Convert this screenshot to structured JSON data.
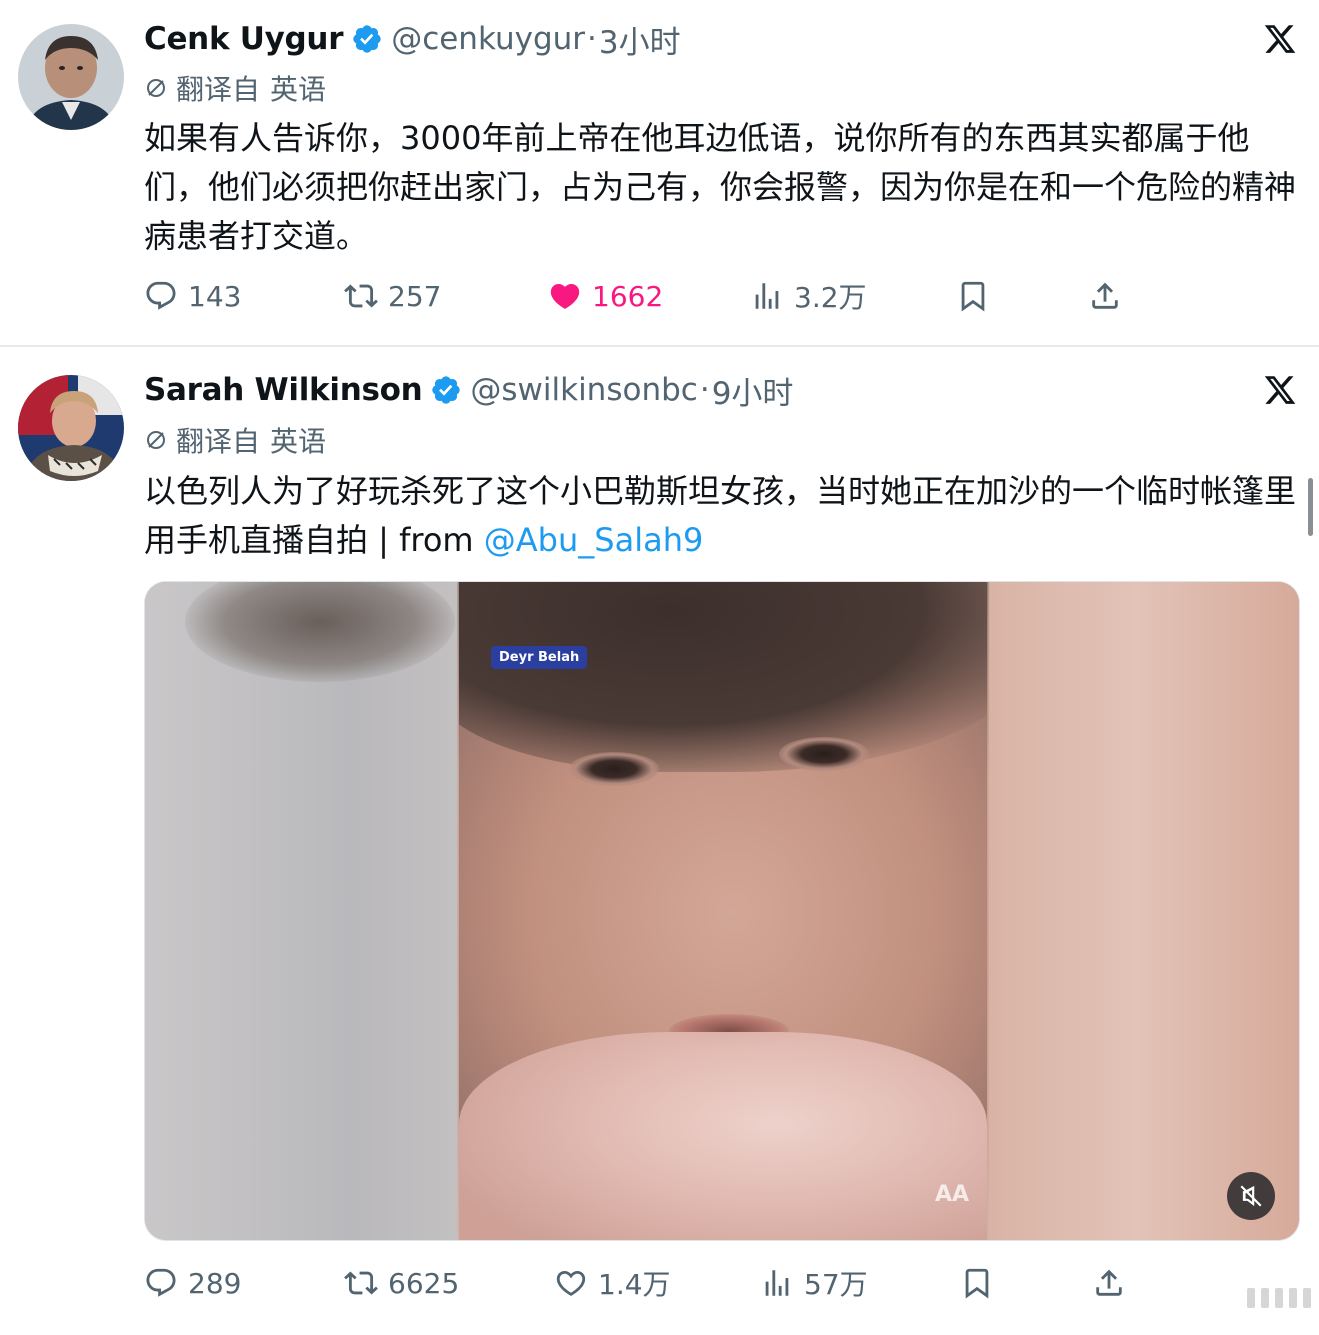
{
  "tweets": [
    {
      "name": "Cenk Uygur",
      "handle": "@cenkuygur",
      "separator": "·",
      "time": "3小时",
      "translated_label": "翻译自",
      "translated_lang": "英语",
      "text": "如果有人告诉你，3000年前上帝在他耳边低语，说你所有的东西其实都属于他们，他们必须把你赶出家门，占为己有，你会报警，因为你是在和一个危险的精神病患者打交道。",
      "actions": {
        "replies": "143",
        "reposts": "257",
        "likes": "1662",
        "views": "3.2万"
      },
      "liked": true
    },
    {
      "name": "Sarah Wilkinson",
      "handle": "@swilkinsonbc",
      "separator": "·",
      "time": "9小时",
      "translated_label": "翻译自",
      "translated_lang": "英语",
      "text": "以色列人为了好玩杀死了这个小巴勒斯坦女孩，当时她正在加沙的一个临时帐篷里用手机直播自拍 | from ",
      "mention": "@Abu_Salah9",
      "media": {
        "location_tag": "Deyr Belah",
        "watermark": "AA"
      },
      "actions": {
        "replies": "289",
        "reposts": "6625",
        "likes": "1.4万",
        "views": "57万"
      },
      "liked": false
    }
  ],
  "colors": {
    "text": "#0f1419",
    "secondary": "#536471",
    "like": "#f91880",
    "link": "#1d9bf0",
    "verified": "#1d9bf0"
  },
  "icons": [
    "reply-icon",
    "repost-icon",
    "like-icon",
    "views-icon",
    "bookmark-icon",
    "share-icon",
    "x-logo-icon",
    "verified-badge-icon",
    "translate-icon",
    "mute-icon"
  ]
}
